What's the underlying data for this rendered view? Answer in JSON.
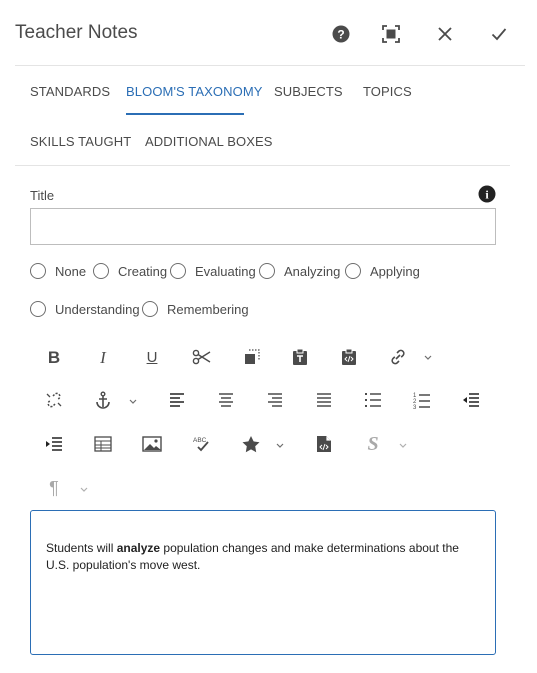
{
  "dialog": {
    "title": "Teacher Notes",
    "help_label": "?",
    "fullscreen_label": "Fullscreen",
    "close_label": "Close",
    "done_label": "Done"
  },
  "tabs": [
    {
      "label": "STANDARDS",
      "active": false
    },
    {
      "label": "BLOOM'S TAXONOMY",
      "active": true
    },
    {
      "label": "SUBJECTS",
      "active": false
    },
    {
      "label": "TOPICS",
      "active": false
    },
    {
      "label": "SKILLS TAUGHT",
      "active": false
    },
    {
      "label": "ADDITIONAL BOXES",
      "active": false
    }
  ],
  "form": {
    "title_label": "Title",
    "title_value": "",
    "info_label": "i"
  },
  "bloom_levels": [
    {
      "label": "None",
      "selected": false
    },
    {
      "label": "Creating",
      "selected": false
    },
    {
      "label": "Evaluating",
      "selected": false
    },
    {
      "label": "Analyzing",
      "selected": false
    },
    {
      "label": "Applying",
      "selected": false
    },
    {
      "label": "Understanding",
      "selected": false
    },
    {
      "label": "Remembering",
      "selected": false
    }
  ],
  "toolbar": {
    "bold": "B",
    "italic": "I",
    "underline": "U",
    "strike": "S",
    "paragraph": "¶",
    "spellcheck": "ABC"
  },
  "editor": {
    "text_before": "Students will ",
    "text_bold": "analyze",
    "text_after": " population changes and make determinations about the U.S. population's move west."
  },
  "colors": {
    "accent": "#2b6eb5",
    "text": "#4b4b4b",
    "border": "#bdbdbd"
  }
}
